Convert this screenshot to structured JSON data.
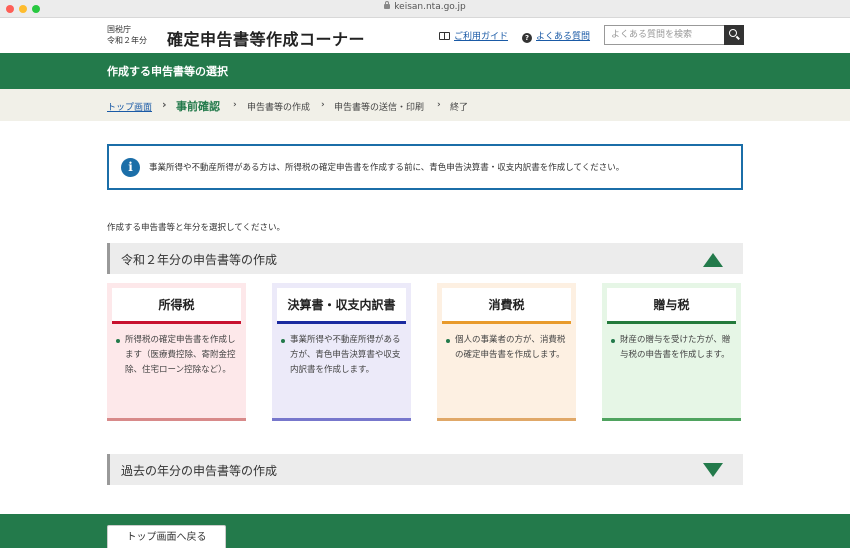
{
  "browser": {
    "url": "keisan.nta.go.jp"
  },
  "header": {
    "agency": "国税庁",
    "year": "令和２年分",
    "title": "確定申告書等作成コーナー",
    "guide_link": "ご利用ガイド",
    "faq_link": "よくある質問",
    "search_placeholder": "よくある質問を検索"
  },
  "page_title": "作成する申告書等の選択",
  "breadcrumb": {
    "top": "トップ画面",
    "current": "事前確認",
    "step3": "申告書等の作成",
    "step4": "申告書等の送信・印刷",
    "step5": "終了",
    "separator": "›"
  },
  "info": {
    "icon": "i",
    "text": "事業所得や不動産所得がある方は、所得税の確定申告書を作成する前に、青色申告決算書・収支内訳書を作成してください。"
  },
  "instruction": "作成する申告書等と年分を選択してください。",
  "section_current": {
    "title": "令和２年分の申告書等の作成",
    "state": "expanded"
  },
  "cards": [
    {
      "title": "所得税",
      "desc": "所得税の確定申告書を作成します（医療費控除、寄附金控除、住宅ローン控除など）。",
      "bg": "#fde8ea",
      "accent": "#c8102e",
      "border": "#d88a8a"
    },
    {
      "title": "決算書・収支内訳書",
      "desc": "事業所得や不動産所得がある方が、青色申告決算書や収支内訳書を作成します。",
      "bg": "#eceaf9",
      "accent": "#1a2aa0",
      "border": "#7777cc"
    },
    {
      "title": "消費税",
      "desc": "個人の事業者の方が、消費税の確定申告書を作成します。",
      "bg": "#fdf0e2",
      "accent": "#e89a2b",
      "border": "#e0a868"
    },
    {
      "title": "贈与税",
      "desc": "財産の贈与を受けた方が、贈与税の申告書を作成します。",
      "bg": "#e6f6e6",
      "accent": "#237a3b",
      "border": "#4fa35f"
    }
  ],
  "section_past": {
    "title": "過去の年分の申告書等の作成",
    "state": "collapsed"
  },
  "back_button": "トップ画面へ戻る",
  "colors": {
    "brand_green": "#237a4b",
    "info_blue": "#1b6ea8",
    "link_blue": "#1a5aa6"
  }
}
